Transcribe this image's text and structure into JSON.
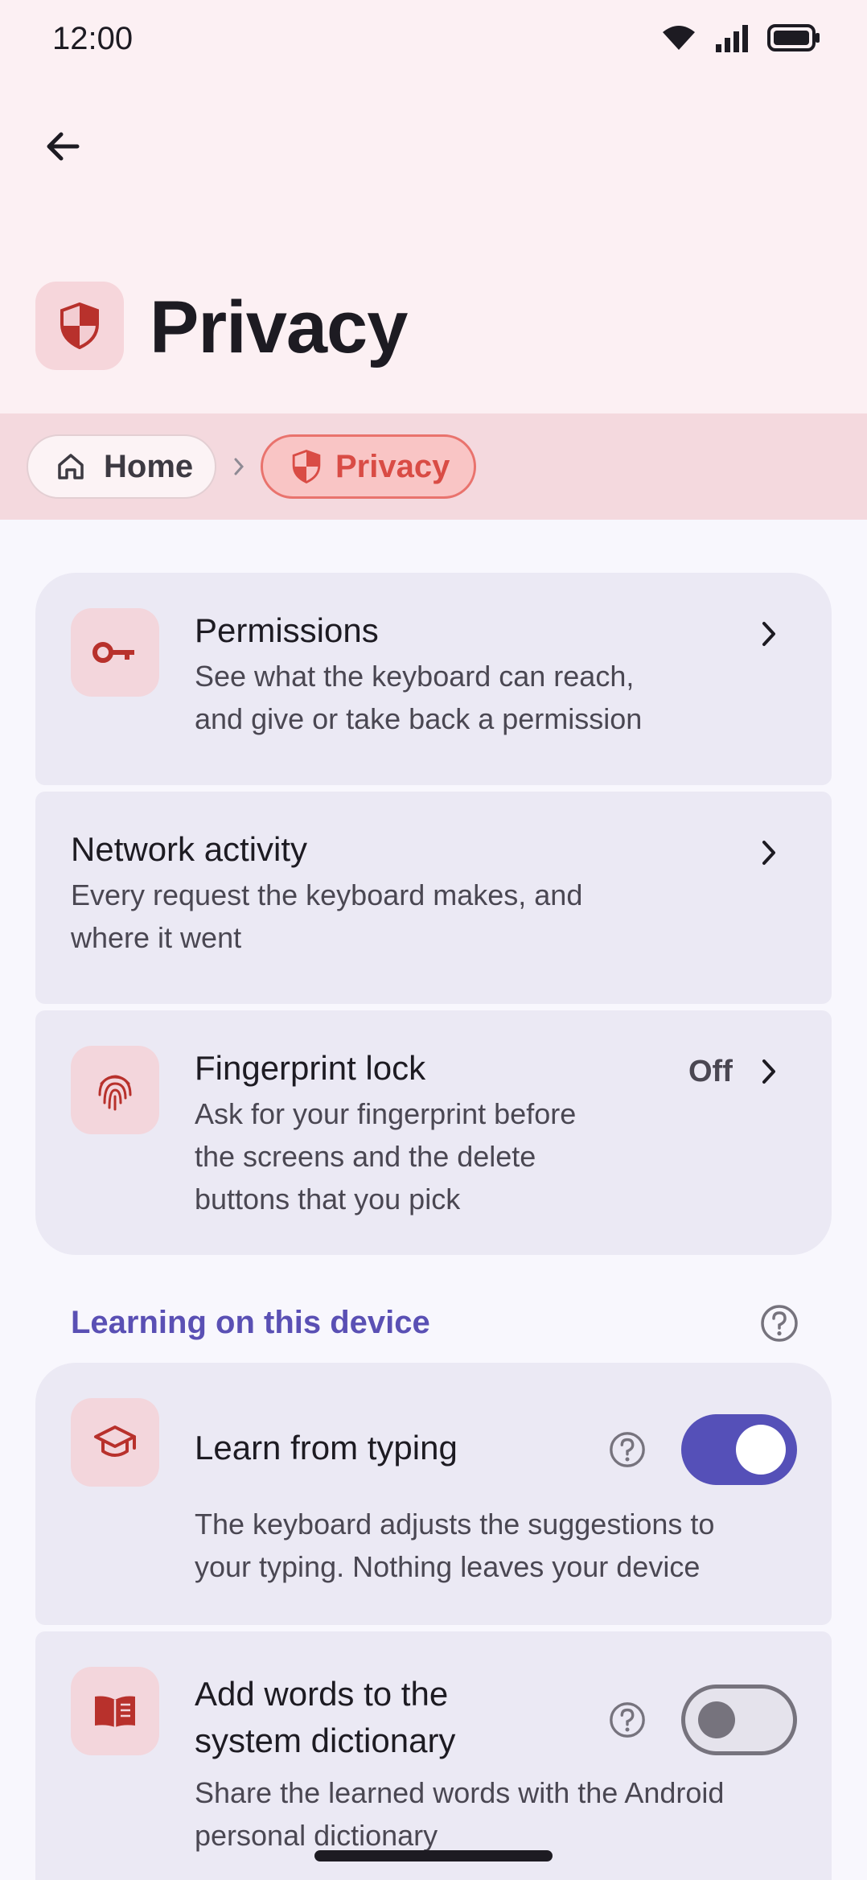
{
  "status_bar": {
    "time": "12:00"
  },
  "header": {
    "title": "Privacy"
  },
  "breadcrumb": {
    "home": "Home",
    "current": "Privacy"
  },
  "cards": {
    "permissions": {
      "title": "Permissions",
      "desc_line1": "See what the keyboard can reach,",
      "desc_line2": "and give or take back a permission"
    },
    "network": {
      "title": "Network activity",
      "desc_line1": "Every request the keyboard makes, and",
      "desc_line2": "where it went"
    },
    "fingerprint": {
      "title": "Fingerprint lock",
      "value": "Off",
      "desc_line1": "Ask for your fingerprint before",
      "desc_line2": "the screens and the delete",
      "desc_line3": "buttons that you pick"
    }
  },
  "learning": {
    "header": "Learning on this device",
    "learn_typing": {
      "title": "Learn from typing",
      "enabled": true,
      "desc_line1": "The keyboard adjusts the suggestions to",
      "desc_line2": "your typing. Nothing leaves your device"
    },
    "add_words": {
      "title_line1": "Add words to the",
      "title_line2": "system dictionary",
      "enabled": false,
      "desc_line1": "Share the learned words with the Android",
      "desc_line2": "personal dictionary"
    }
  },
  "colors": {
    "accent": "#5550b8",
    "brand_red": "#c0302c",
    "chip_bg": "#f9c5c5",
    "card_bg": "#ebe9f4",
    "header_bg": "#fcf0f3"
  }
}
